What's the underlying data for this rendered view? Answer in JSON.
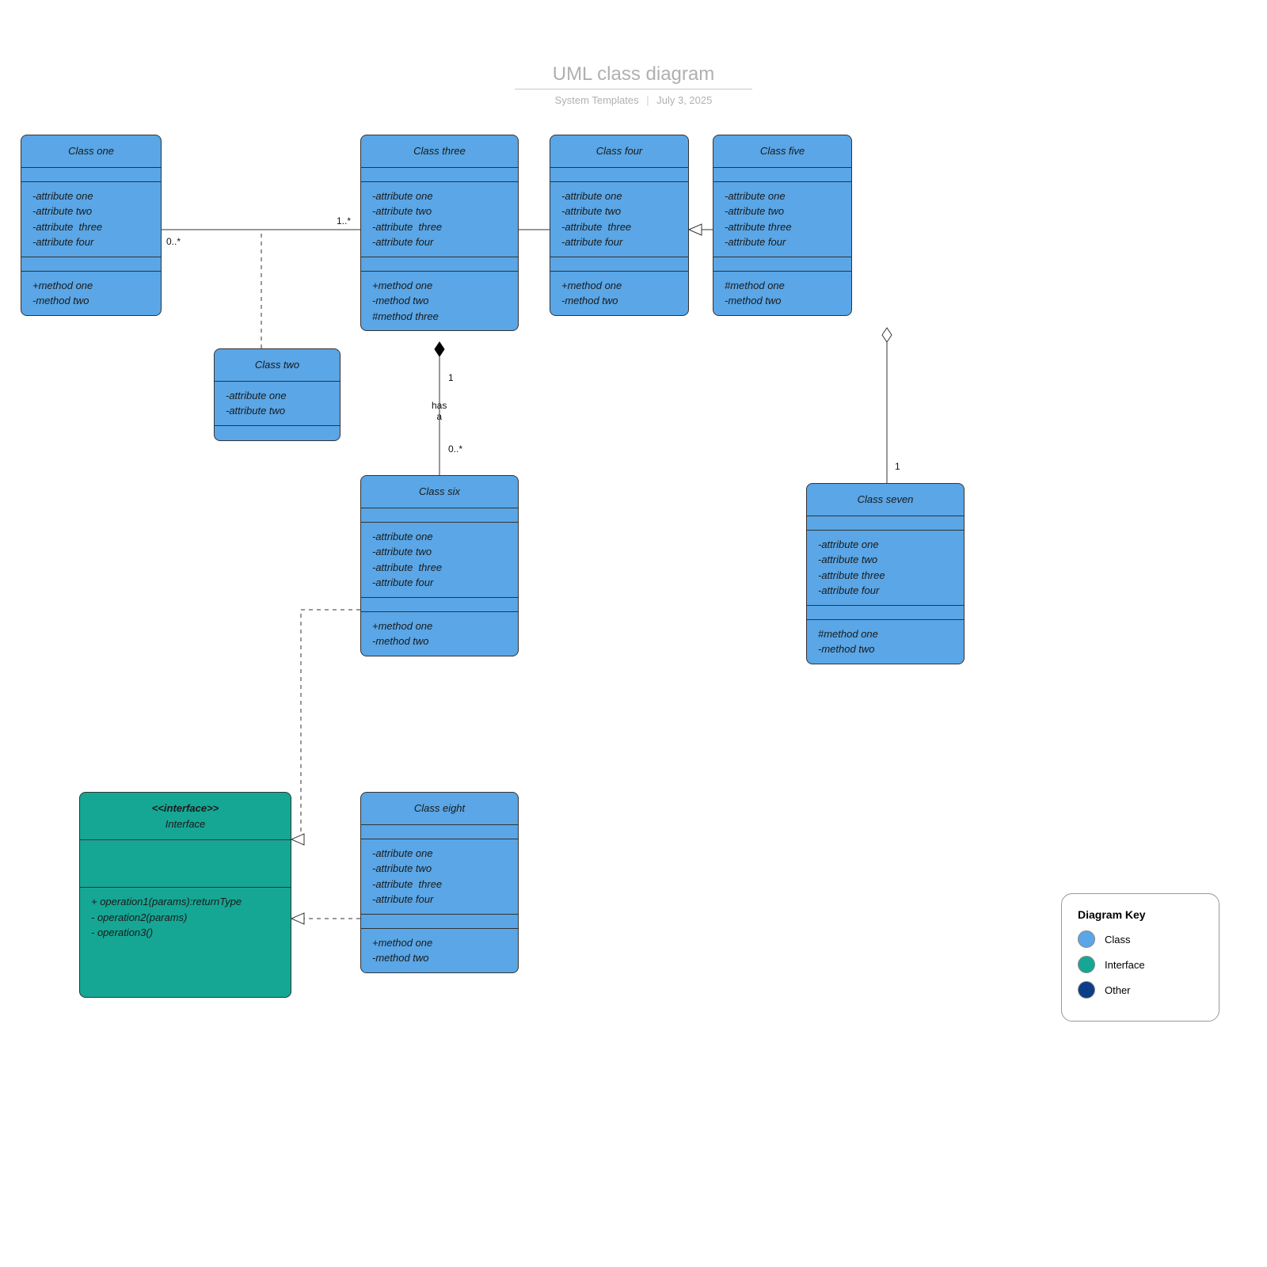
{
  "header": {
    "title": "UML class diagram",
    "subtitle_left": "System Templates",
    "subtitle_right": "July 3, 2025"
  },
  "classes": {
    "one": {
      "name": "Class one",
      "attrs": [
        "-attribute one",
        "-attribute two",
        "-attribute  three",
        "-attribute four"
      ],
      "methods": [
        "+method one",
        "-method two"
      ]
    },
    "two": {
      "name": "Class two",
      "attrs": [
        "-attribute one",
        "-attribute two"
      ],
      "methods": []
    },
    "three": {
      "name": "Class three",
      "attrs": [
        "-attribute one",
        "-attribute two",
        "-attribute  three",
        "-attribute four"
      ],
      "methods": [
        "+method one",
        "-method two",
        "#method three"
      ]
    },
    "four": {
      "name": "Class four",
      "attrs": [
        "-attribute one",
        "-attribute two",
        "-attribute  three",
        "-attribute four"
      ],
      "methods": [
        "+method one",
        "-method two"
      ]
    },
    "five": {
      "name": "Class five",
      "attrs": [
        "-attribute one",
        "-attribute two",
        "-attribute three",
        "-attribute four"
      ],
      "methods": [
        "#method one",
        "-method two"
      ]
    },
    "six": {
      "name": "Class six",
      "attrs": [
        "-attribute one",
        "-attribute two",
        "-attribute  three",
        "-attribute four"
      ],
      "methods": [
        "+method one",
        "-method two"
      ]
    },
    "seven": {
      "name": "Class seven",
      "attrs": [
        "-attribute one",
        "-attribute two",
        "-attribute three",
        "-attribute four"
      ],
      "methods": [
        "#method one",
        "-method two"
      ]
    },
    "eight": {
      "name": "Class eight",
      "attrs": [
        "-attribute one",
        "-attribute two",
        "-attribute  three",
        "-attribute four"
      ],
      "methods": [
        "+method one",
        "-method two"
      ]
    }
  },
  "interface": {
    "stereotype": "<<interface>>",
    "name": "Interface",
    "ops": [
      "+ operation1(params):returnType",
      "- operation2(params)",
      "- operation3()"
    ]
  },
  "legend": {
    "title": "Diagram Key",
    "items": [
      {
        "label": "Class",
        "color": "blue"
      },
      {
        "label": "Interface",
        "color": "teal"
      },
      {
        "label": "Other",
        "color": "navy"
      }
    ]
  },
  "labels": {
    "one_three_left": "0..*",
    "one_three_right": "1..*",
    "three_six_top": "1",
    "three_six_rel": "has\na",
    "three_six_bot": "0..*",
    "five_seven": "1"
  },
  "chart_data": {
    "type": "uml_class_diagram",
    "title": "UML class diagram",
    "nodes": [
      {
        "id": "Class one",
        "kind": "class",
        "attributes": [
          "-attribute one",
          "-attribute two",
          "-attribute three",
          "-attribute four"
        ],
        "methods": [
          "+method one",
          "-method two"
        ]
      },
      {
        "id": "Class two",
        "kind": "class",
        "attributes": [
          "-attribute one",
          "-attribute two"
        ],
        "methods": []
      },
      {
        "id": "Class three",
        "kind": "class",
        "attributes": [
          "-attribute one",
          "-attribute two",
          "-attribute three",
          "-attribute four"
        ],
        "methods": [
          "+method one",
          "-method two",
          "#method three"
        ]
      },
      {
        "id": "Class four",
        "kind": "class",
        "attributes": [
          "-attribute one",
          "-attribute two",
          "-attribute three",
          "-attribute four"
        ],
        "methods": [
          "+method one",
          "-method two"
        ]
      },
      {
        "id": "Class five",
        "kind": "class",
        "attributes": [
          "-attribute one",
          "-attribute two",
          "-attribute three",
          "-attribute four"
        ],
        "methods": [
          "#method one",
          "-method two"
        ]
      },
      {
        "id": "Class six",
        "kind": "class",
        "attributes": [
          "-attribute one",
          "-attribute two",
          "-attribute three",
          "-attribute four"
        ],
        "methods": [
          "+method one",
          "-method two"
        ]
      },
      {
        "id": "Class seven",
        "kind": "class",
        "attributes": [
          "-attribute one",
          "-attribute two",
          "-attribute three",
          "-attribute four"
        ],
        "methods": [
          "#method one",
          "-method two"
        ]
      },
      {
        "id": "Class eight",
        "kind": "class",
        "attributes": [
          "-attribute one",
          "-attribute two",
          "-attribute three",
          "-attribute four"
        ],
        "methods": [
          "+method one",
          "-method two"
        ]
      },
      {
        "id": "Interface",
        "kind": "interface",
        "operations": [
          "+ operation1(params):returnType",
          "- operation2(params)",
          "- operation3()"
        ]
      }
    ],
    "edges": [
      {
        "from": "Class one",
        "to": "Class three",
        "type": "association",
        "from_mult": "0..*",
        "to_mult": "1..*"
      },
      {
        "from": "Class two",
        "to": "association(Class one–Class three)",
        "type": "dependency"
      },
      {
        "from": "Class three",
        "to": "Class four",
        "type": "generalization"
      },
      {
        "from": "Class five",
        "to": "Class four",
        "type": "generalization"
      },
      {
        "from": "Class six",
        "to": "Class three",
        "type": "composition",
        "label": "has a",
        "from_mult": "0..*",
        "to_mult": "1"
      },
      {
        "from": "Class seven",
        "to": "Class five",
        "type": "aggregation",
        "to_mult": "1"
      },
      {
        "from": "Class six",
        "to": "Interface",
        "type": "realization"
      },
      {
        "from": "Class eight",
        "to": "Interface",
        "type": "realization"
      }
    ]
  }
}
